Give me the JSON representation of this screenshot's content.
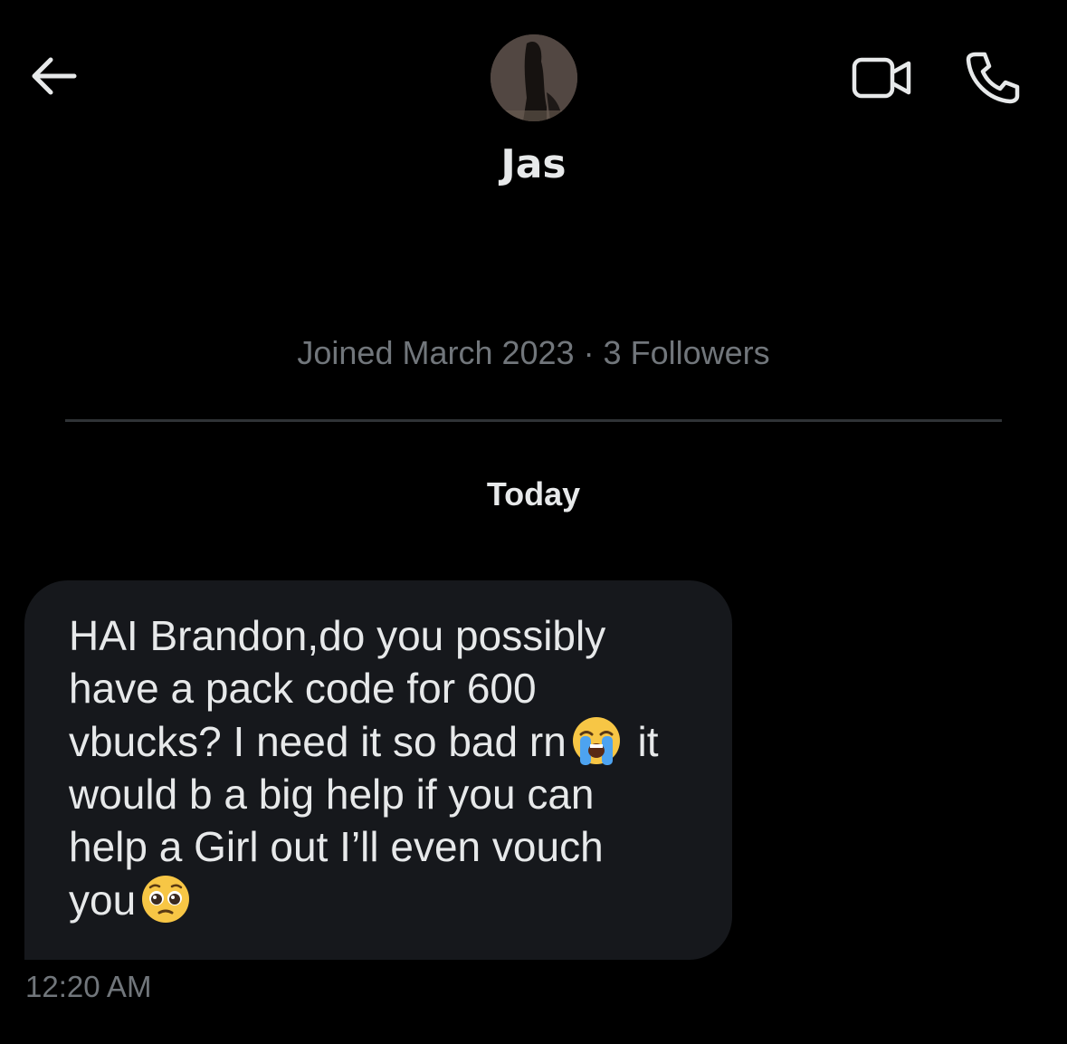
{
  "header": {
    "back_icon": "arrow-left-icon",
    "video_icon": "video-camera-icon",
    "phone_icon": "phone-icon",
    "contact_name": "Jas",
    "icon_color": "#e7e9ea"
  },
  "profile": {
    "meta": "Joined March 2023 · 3 Followers"
  },
  "conversation": {
    "date_separator": "Today",
    "message": {
      "line1": "HAI Brandon,do you possibly",
      "line2": "have a pack code for 600",
      "line3a": "vbucks? I need it so bad rn",
      "emoji1": "loudly-crying-face-emoji",
      "line3b": " it",
      "line4": "would b a big help if you can",
      "line5": "help a Girl out I’ll even vouch",
      "line6": "you",
      "emoji2": "pleading-face-emoji",
      "timestamp": "12:20 AM"
    }
  },
  "colors": {
    "background": "#000000",
    "bubble": "#16181c",
    "text_primary": "#e7e9ea",
    "text_secondary": "#71767b",
    "divider": "#2f3336"
  }
}
